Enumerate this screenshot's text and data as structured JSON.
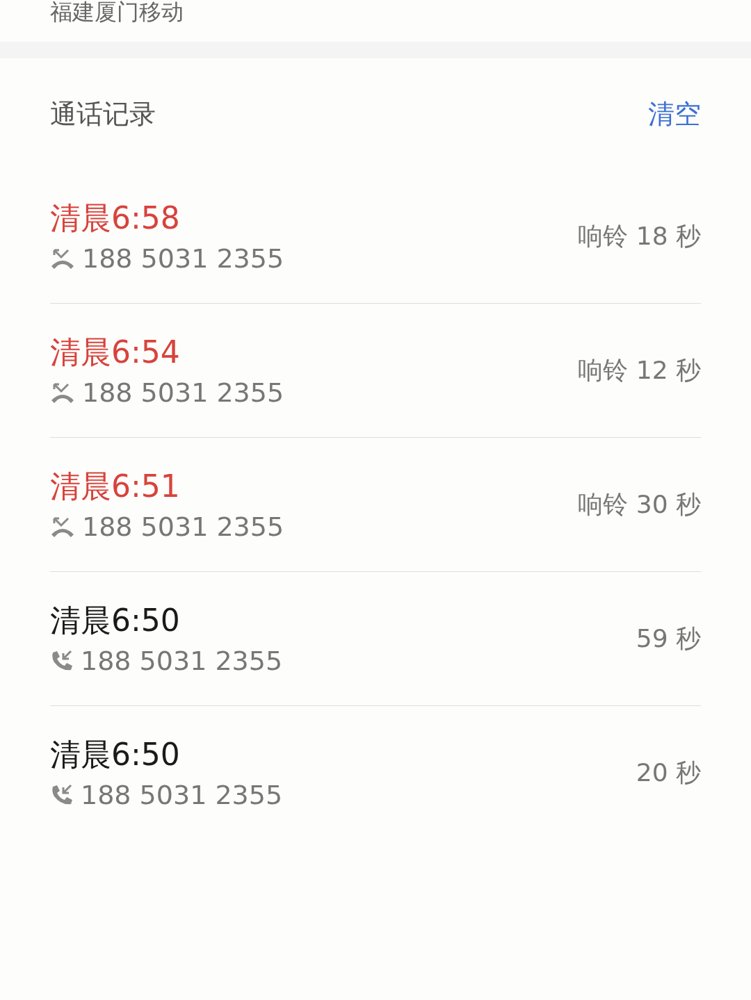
{
  "carrier": "福建厦门移动",
  "call_log": {
    "title": "通话记录",
    "clear_button": "清空",
    "calls": [
      {
        "kind": "missed",
        "time": "清晨6:58",
        "number": "188 5031 2355",
        "duration": "响铃 18 秒"
      },
      {
        "kind": "missed",
        "time": "清晨6:54",
        "number": "188 5031 2355",
        "duration": "响铃 12 秒"
      },
      {
        "kind": "missed",
        "time": "清晨6:51",
        "number": "188 5031 2355",
        "duration": "响铃 30 秒"
      },
      {
        "kind": "incoming",
        "time": "清晨6:50",
        "number": "188 5031 2355",
        "duration": "59 秒"
      },
      {
        "kind": "incoming",
        "time": "清晨6:50",
        "number": "188 5031 2355",
        "duration": "20 秒"
      }
    ]
  }
}
